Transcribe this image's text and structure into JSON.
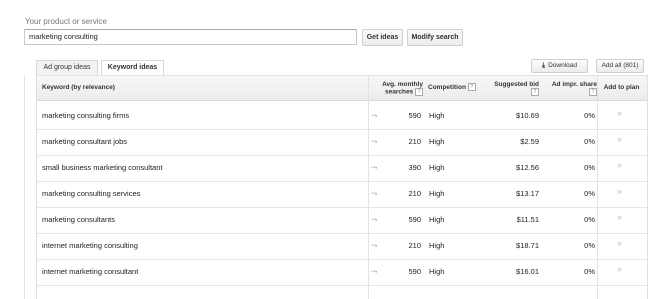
{
  "search": {
    "label": "Your product or service",
    "value": "marketing consulting",
    "get_ideas": "Get ideas",
    "modify_search": "Modify search"
  },
  "tabs": [
    {
      "label": "Ad group ideas"
    },
    {
      "label": "Keyword ideas"
    }
  ],
  "toolbar": {
    "download_label": "Download",
    "add_all_label": "Add all (801)"
  },
  "table": {
    "headers": {
      "keyword": "Keyword (by relevance)",
      "avg_line1": "Avg. monthly",
      "avg_line2": "searches",
      "competition": "Competition",
      "bid_line1": "Suggested bid",
      "impr_line1": "Ad impr. share",
      "add_to_plan": "Add to plan",
      "help": "?"
    },
    "rows": [
      {
        "keyword": "marketing consulting firms",
        "volume": "590",
        "competition": "High",
        "bid": "$10.69",
        "impr": "0%"
      },
      {
        "keyword": "marketing consultant jobs",
        "volume": "210",
        "competition": "High",
        "bid": "$2.59",
        "impr": "0%"
      },
      {
        "keyword": "small business marketing consultant",
        "volume": "390",
        "competition": "High",
        "bid": "$12.56",
        "impr": "0%"
      },
      {
        "keyword": "marketing consulting services",
        "volume": "210",
        "competition": "High",
        "bid": "$13.17",
        "impr": "0%"
      },
      {
        "keyword": "marketing consultants",
        "volume": "590",
        "competition": "High",
        "bid": "$11.51",
        "impr": "0%"
      },
      {
        "keyword": "internet marketing consulting",
        "volume": "210",
        "competition": "High",
        "bid": "$18.71",
        "impr": "0%"
      },
      {
        "keyword": "internet marketing consultant",
        "volume": "590",
        "competition": "High",
        "bid": "$16.01",
        "impr": "0%"
      }
    ]
  },
  "icons": {
    "trend": "chart-icon",
    "add": "double-chevron-right-icon",
    "download": "download-icon"
  }
}
